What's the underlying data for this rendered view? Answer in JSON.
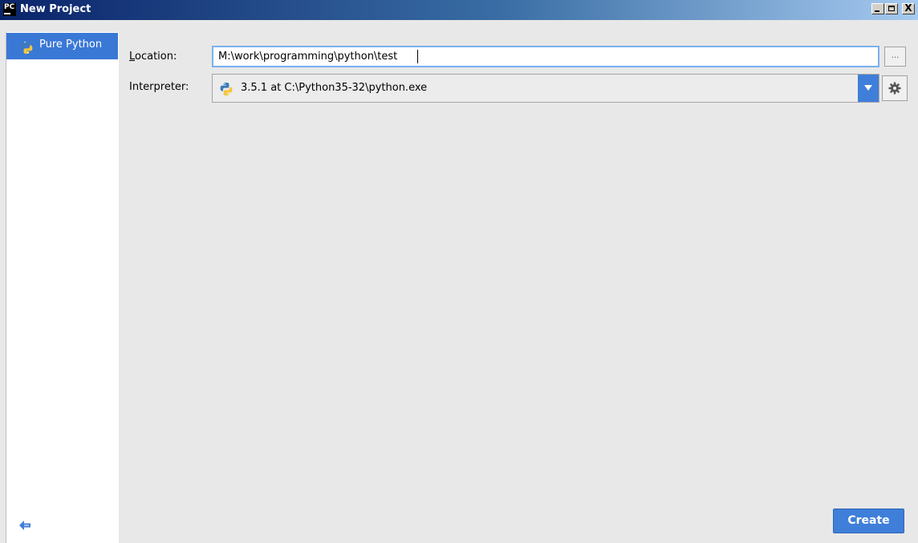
{
  "window": {
    "app_logo_text": "PC",
    "title": "New Project",
    "controls": {
      "minimize": "_",
      "maximize": "□",
      "close": "X"
    }
  },
  "sidebar": {
    "items": [
      {
        "label": "Pure Python",
        "icon": "python-icon",
        "selected": true
      }
    ],
    "back_icon": "back-arrow-icon"
  },
  "form": {
    "location": {
      "label_access": "L",
      "label_rest": "ocation:",
      "value": "M:\\work\\programming\\python\\test",
      "browse_label": "..."
    },
    "interpreter": {
      "label": "Interpreter:",
      "value": "3.5.1 at C:\\Python35-32\\python.exe",
      "icon": "python-icon"
    }
  },
  "footer": {
    "create_label": "Create"
  },
  "colors": {
    "accent": "#3f7fd9",
    "selection": "#3a78d6",
    "titlebar_start": "#0a246a",
    "panel_bg": "#e8e8e8"
  }
}
